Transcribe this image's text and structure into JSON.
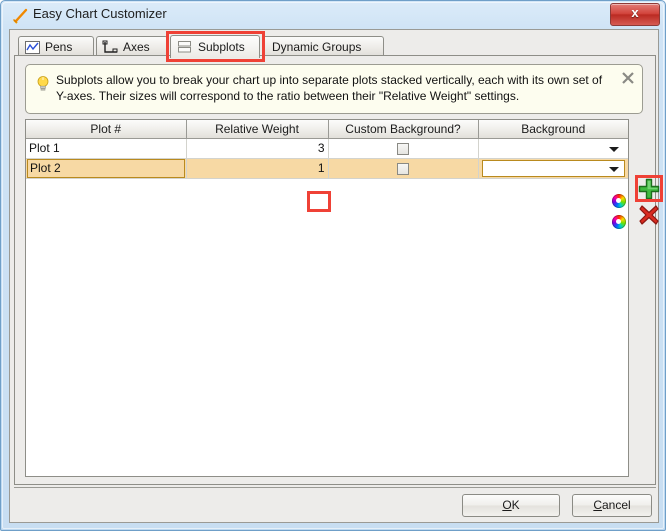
{
  "window": {
    "title": "Easy Chart Customizer",
    "title_icon": "pen-chart-icon",
    "close_label": "x"
  },
  "tabs": [
    {
      "id": "pens",
      "label": "Pens",
      "icon": "line-chart-icon",
      "selected": false
    },
    {
      "id": "axes",
      "label": "Axes",
      "icon": "axes-icon",
      "selected": false
    },
    {
      "id": "subplots",
      "label": "Subplots",
      "icon": "stacked-plots-icon",
      "selected": true
    },
    {
      "id": "dynamic-groups",
      "label": "Dynamic Groups",
      "icon": "",
      "selected": false
    }
  ],
  "info": {
    "icon": "lightbulb-icon",
    "text": "Subplots allow you to break your chart up into separate plots stacked vertically, each with its own set of Y-axes. Their sizes will correspond to the ratio between their \"Relative Weight\" settings.",
    "close_icon": "close-icon"
  },
  "table": {
    "columns": [
      "Plot #",
      "Relative Weight",
      "Custom Background?",
      "Background"
    ],
    "rows": [
      {
        "plot": "Plot 1",
        "relative_weight": "3",
        "custom_background": false,
        "background": "",
        "selected": false
      },
      {
        "plot": "Plot 2",
        "relative_weight": "1",
        "custom_background": false,
        "background": "",
        "selected": true
      }
    ]
  },
  "side_actions": {
    "add_label": "+",
    "remove_label": "x",
    "add_icon": "green-plus-icon",
    "remove_icon": "red-x-icon"
  },
  "footer": {
    "ok": {
      "pre": "",
      "mnemonic": "O",
      "post": "K"
    },
    "cancel": {
      "pre": "",
      "mnemonic": "C",
      "post": "ancel"
    }
  },
  "colors": {
    "highlight_red": "#ef4136",
    "selected_row": "#f7d9a4",
    "selected_row_border": "#b98a1e",
    "info_bg": "#fdfdef",
    "titlebar": "#cfe3f5"
  }
}
